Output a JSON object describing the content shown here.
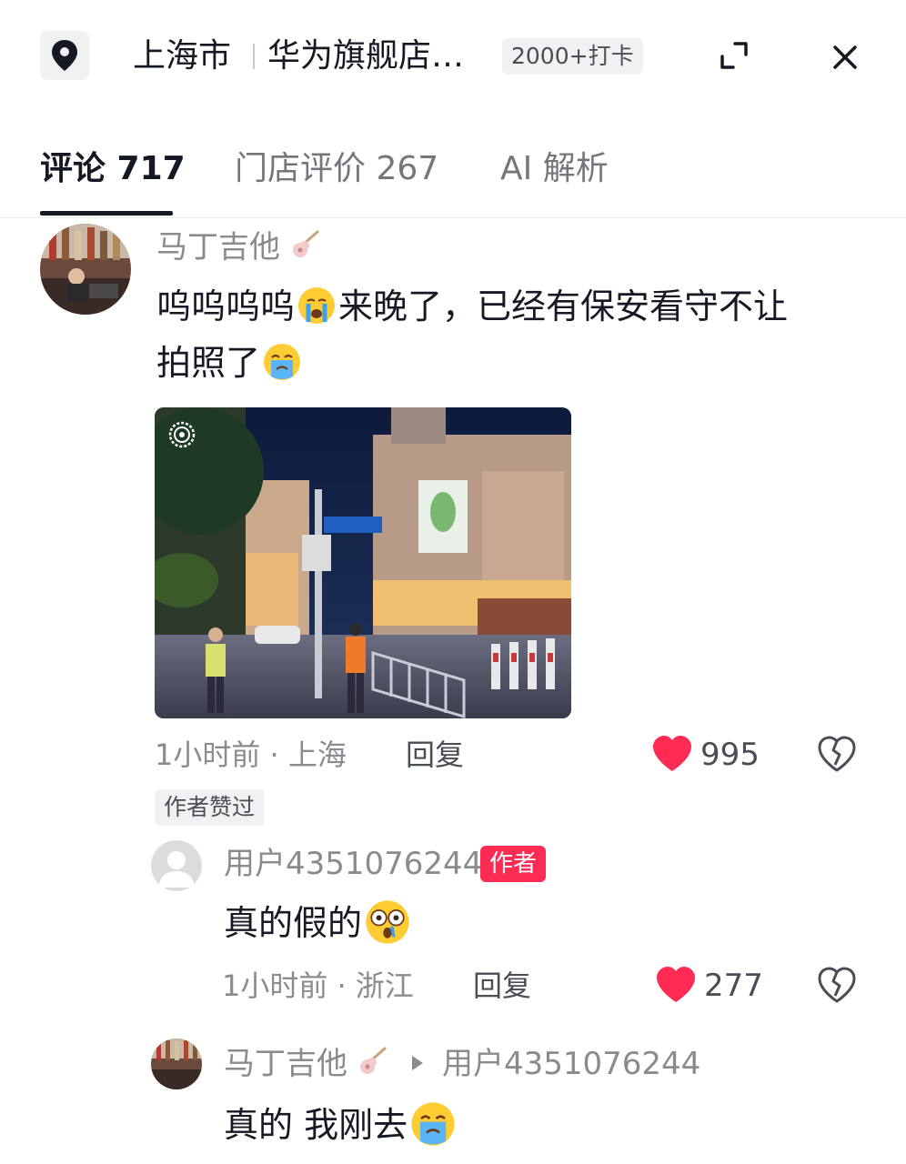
{
  "header": {
    "city": "上海市",
    "store_name": "华为旗舰店…",
    "checkins": "2000+打卡"
  },
  "tabs": [
    {
      "label": "评论 717",
      "active": true
    },
    {
      "label": "门店评价 267",
      "active": false
    },
    {
      "label": "AI 解析",
      "active": false
    }
  ],
  "comments": [
    {
      "user": "马丁吉他",
      "text_part1": "呜呜呜呜",
      "text_part2": "来晚了，已经有保安看守不让",
      "text_part3": "拍照了",
      "time": "1小时前 · 上海",
      "reply": "回复",
      "likes": "995",
      "author_liked": "作者赞过"
    }
  ],
  "replies": [
    {
      "user": "用户4351076244",
      "badge": "作者",
      "text": "真的假的",
      "time": "1小时前 · 浙江",
      "reply": "回复",
      "likes": "277"
    },
    {
      "user": "马丁吉他",
      "reply_to": "用户4351076244",
      "text": "真的 我刚去"
    }
  ],
  "colors": {
    "like": "#fe2c55",
    "author_badge": "#fe2c55",
    "text_primary": "#161823",
    "text_secondary": "#8a8b91"
  },
  "icons": [
    "location-pin-icon",
    "expand-icon",
    "close-icon",
    "heart-icon",
    "broken-heart-icon",
    "guitar-icon",
    "crying-emoji",
    "shocked-emoji",
    "reply-arrow-icon"
  ]
}
